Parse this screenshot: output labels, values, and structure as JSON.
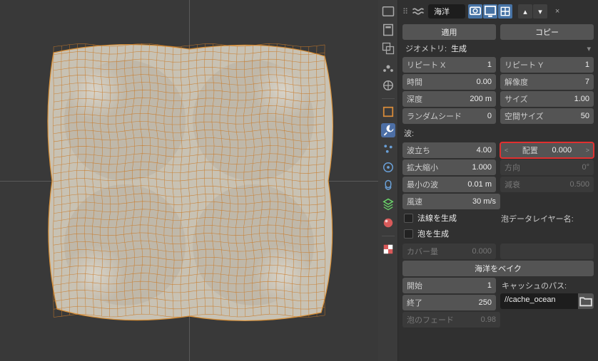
{
  "header": {
    "modifier_name": "海洋",
    "close": "×"
  },
  "buttons": {
    "apply": "適用",
    "copy": "コピー",
    "bake": "海洋をベイク"
  },
  "geometry": {
    "label": "ジオメトリ:",
    "value": "生成"
  },
  "props": {
    "repeat_x": {
      "label": "リピート X",
      "value": "1"
    },
    "repeat_y": {
      "label": "リピート Y",
      "value": "1"
    },
    "time": {
      "label": "時間",
      "value": "0.00"
    },
    "resolution": {
      "label": "解像度",
      "value": "7"
    },
    "depth": {
      "label": "深度",
      "value": "200 m"
    },
    "size": {
      "label": "サイズ",
      "value": "1.00"
    },
    "random_seed": {
      "label": "ランダムシード",
      "value": "0"
    },
    "spatial_size": {
      "label": "空間サイズ",
      "value": "50"
    }
  },
  "wave": {
    "heading": "波:",
    "choppiness": {
      "label": "波立ち",
      "value": "4.00"
    },
    "alignment": {
      "label": "配置",
      "value": "0.000"
    },
    "scale": {
      "label": "拡大縮小",
      "value": "1.000"
    },
    "direction": {
      "label": "方向",
      "value": "0°"
    },
    "smallest_wave": {
      "label": "最小の波",
      "value": "0.01 m"
    },
    "damping": {
      "label": "減衰",
      "value": "0.500"
    },
    "wind_velocity": {
      "label": "風速",
      "value": "30 m/s"
    }
  },
  "gen": {
    "normals": "法線を生成",
    "foam": "泡を生成",
    "foam_layer": "泡データレイヤー名:",
    "coverage": {
      "label": "カバー量",
      "value": "0.000"
    }
  },
  "bake": {
    "start": {
      "label": "開始",
      "value": "1"
    },
    "end": {
      "label": "終了",
      "value": "250"
    },
    "cache_path_label": "キャッシュのパス:",
    "cache_path": "//cache_ocean",
    "foam_fade": {
      "label": "泡のフェード",
      "value": "0.98"
    }
  }
}
